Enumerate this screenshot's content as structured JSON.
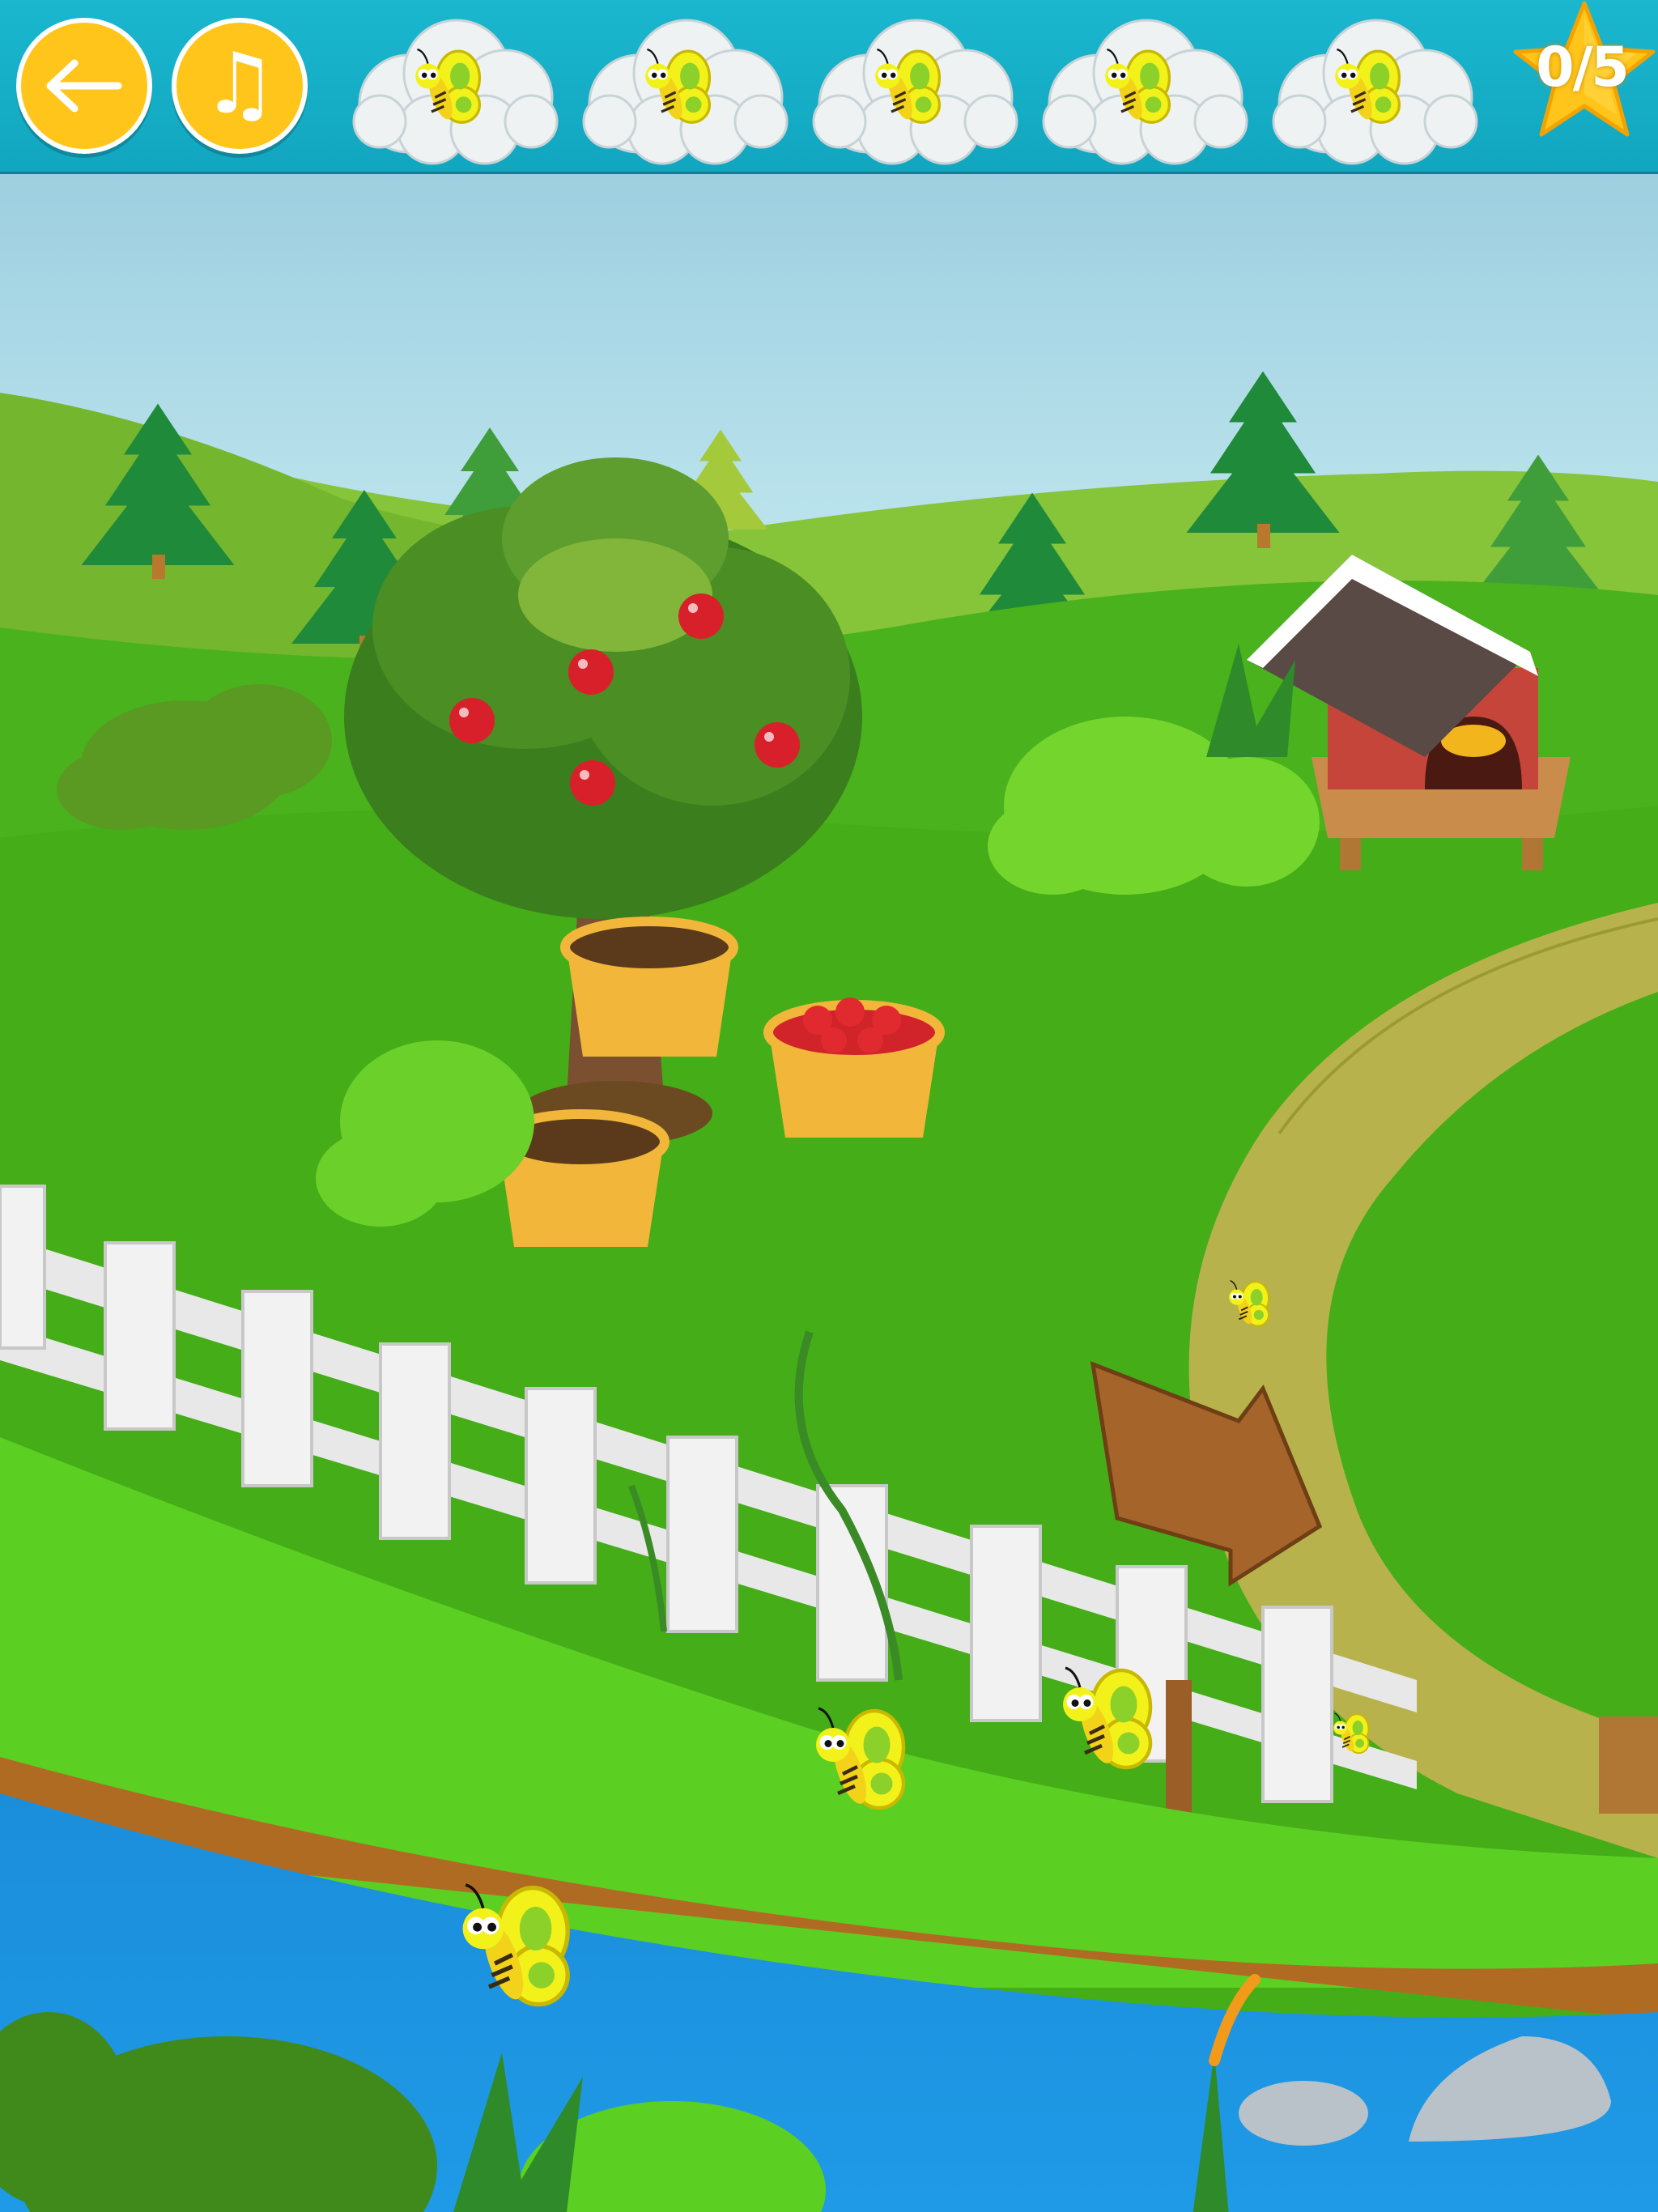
{
  "topbar": {
    "back_icon": "arrow-left-icon",
    "music_icon": "music-note-icon",
    "music_glyph": "♫",
    "slots": [
      "butterfly-in-cloud",
      "butterfly-in-cloud",
      "butterfly-in-cloud",
      "butterfly-in-cloud",
      "butterfly-in-cloud"
    ],
    "score": "0/5"
  },
  "colors": {
    "topbar": "#16afc7",
    "button": "#ffc51a",
    "grass": "#3fae1a",
    "river": "#1a8fdb",
    "butterfly": "#f2f21a"
  },
  "scene": {
    "hidden_butterflies_total": 5,
    "butterflies_found": 0
  }
}
